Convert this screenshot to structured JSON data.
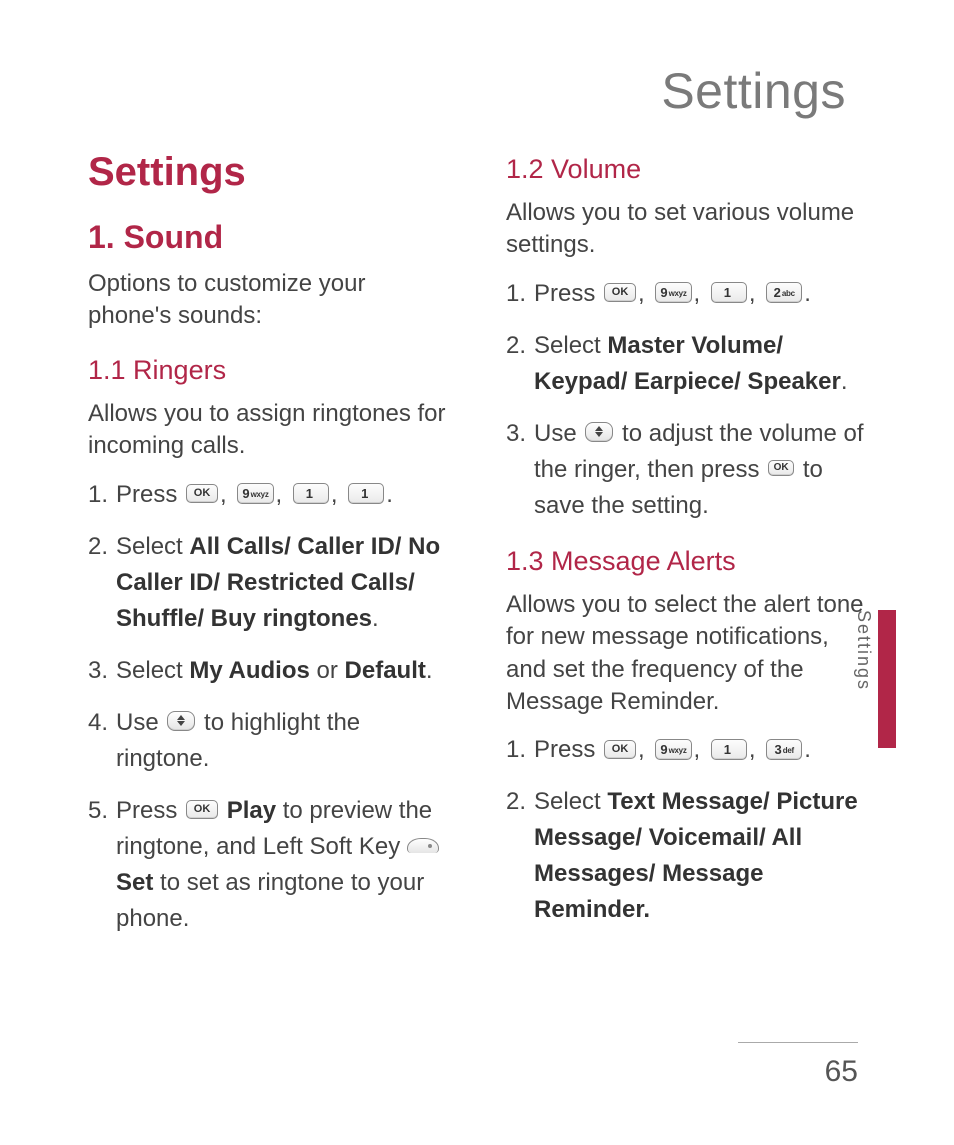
{
  "page_title": "Settings",
  "side_tab": "Settings",
  "page_number": "65",
  "keys": {
    "ok": "OK",
    "k9": {
      "digit": "9",
      "letters": "wxyz"
    },
    "k1": {
      "digit": "1",
      "letters": ""
    },
    "k2": {
      "digit": "2",
      "letters": "abc"
    },
    "k3": {
      "digit": "3",
      "letters": "def"
    }
  },
  "left": {
    "h_settings": "Settings",
    "h_sound": "1. Sound",
    "sound_intro": "Options to customize your phone's sounds:",
    "h_ringers": "1.1 Ringers",
    "ringers_intro": "Allows you to assign ringtones for incoming calls.",
    "steps": {
      "s1_a": "Press ",
      "s2_a": "Select ",
      "s2_b": "All Calls/ Caller ID/ No Caller ID/ Restricted Calls/ Shuffle/ Buy ringtones",
      "s3_a": "Select ",
      "s3_b": "My Audios",
      "s3_c": " or ",
      "s3_d": "Default",
      "s4_a": "Use ",
      "s4_b": " to highlight the ringtone.",
      "s5_a": "Press ",
      "s5_play": "Play",
      "s5_b": " to preview the ringtone, and Left Soft Key ",
      "s5_set": "Set",
      "s5_c": " to set as ringtone to your phone."
    }
  },
  "right": {
    "h_volume": "1.2 Volume",
    "volume_intro": "Allows you to set various volume settings.",
    "vol_steps": {
      "s1_a": "Press ",
      "s2_a": "Select ",
      "s2_b": "Master Volume/ Keypad/ Earpiece/ Speaker",
      "s3_a": "Use ",
      "s3_b": " to adjust the volume of the ringer, then press ",
      "s3_c": " to save the setting."
    },
    "h_msg": "1.3 Message Alerts",
    "msg_intro": "Allows you to select the alert tone for new message notifications, and set the frequency of the Message Reminder.",
    "msg_steps": {
      "s1_a": "Press ",
      "s2_a": "Select ",
      "s2_b": "Text Message/ Picture Message/ Voicemail/ All Messages/ Message Reminder."
    }
  }
}
